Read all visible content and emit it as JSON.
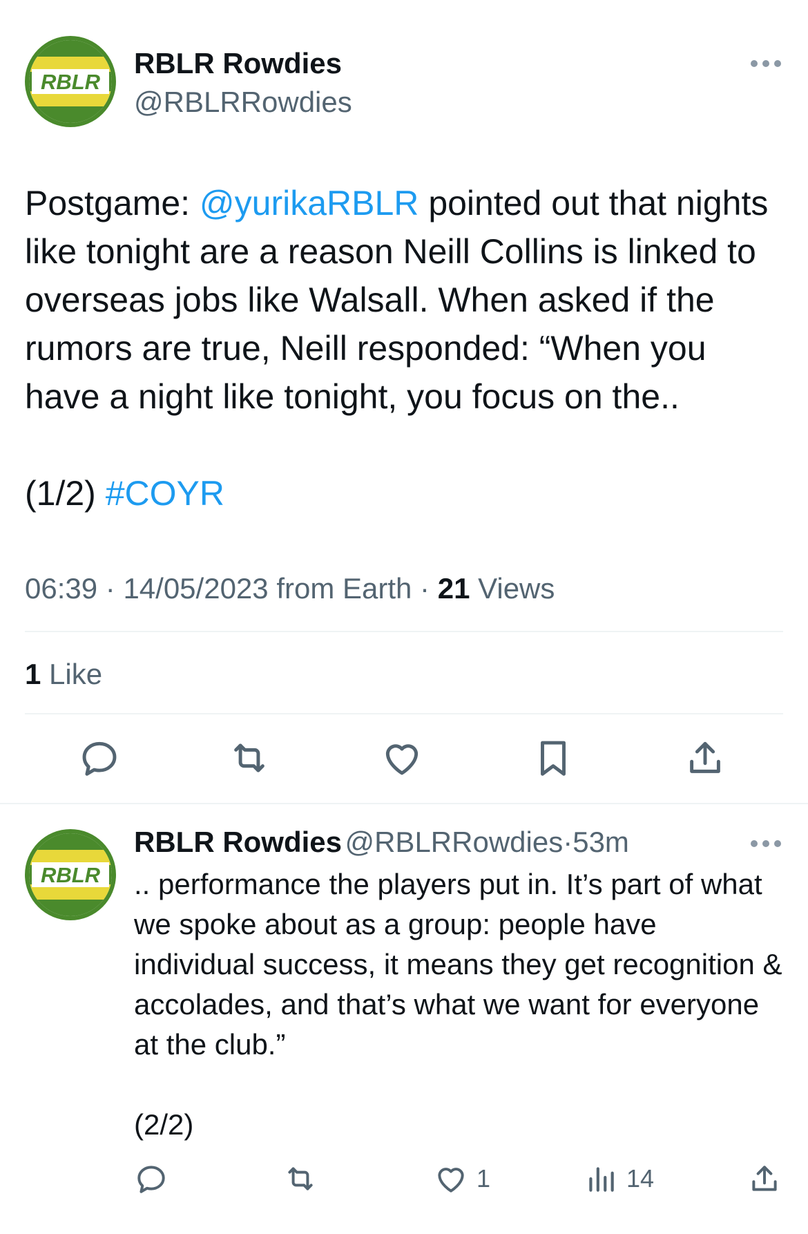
{
  "tweet": {
    "author_name": "RBLR Rowdies",
    "handle": "@RBLRRowdies",
    "avatar_text": "RBLR",
    "text_before_mention": "Postgame: ",
    "mention": "@yurikaRBLR",
    "text_after_mention": " pointed out that nights like tonight are a reason Neill Collins is linked to overseas jobs like Walsall. When asked if the rumors are true, Neill responded: “When you have a night like tonight, you focus on the..",
    "thread_marker": "(1/2) ",
    "hashtag": "#COYR",
    "time": "06:39",
    "date": "14/05/2023",
    "source": "from Earth",
    "views_count": "21",
    "views_label": "Views",
    "likes_count": "1",
    "likes_label": "Like"
  },
  "reply": {
    "author_name": "RBLR Rowdies",
    "handle": "@RBLRRowdies",
    "separator": "·",
    "time_ago": "53m",
    "text": ".. performance the players put in. It’s part of what we spoke about as a group: people have individual success, it means they get recognition & accolades, and that’s what we want for everyone at the club.”",
    "thread_marker": "(2/2)",
    "like_count": "1",
    "views_count": "14"
  },
  "colors": {
    "link": "#1d9bf0",
    "secondary_text": "#536471",
    "avatar_green": "#4a8a2c",
    "avatar_yellow": "#e8d83a"
  }
}
